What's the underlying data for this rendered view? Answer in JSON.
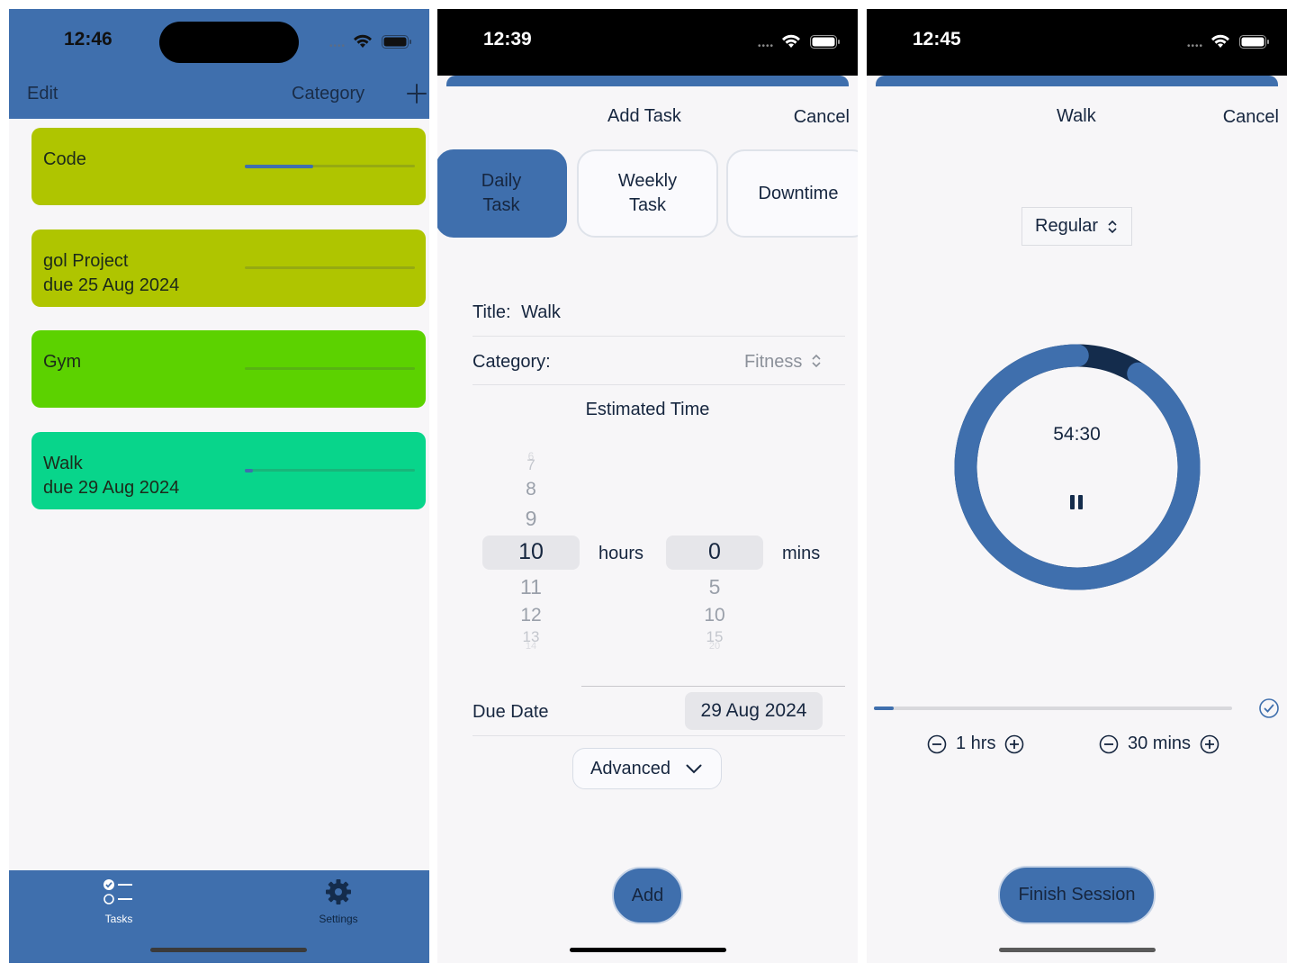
{
  "screen1": {
    "time": "12:46",
    "nav": {
      "edit": "Edit",
      "category": "Category"
    },
    "tasks": [
      {
        "title": "Code",
        "due": "",
        "color": "#afc500",
        "progress": 0.4
      },
      {
        "title": "gol Project",
        "due": "due 25 Aug 2024",
        "color": "#afc500",
        "progress": 0
      },
      {
        "title": "Gym",
        "due": "",
        "color": "#5cd200",
        "progress": 0
      },
      {
        "title": "Walk",
        "due": "due 29 Aug 2024",
        "color": "#08d58b",
        "progress": 0.05
      }
    ],
    "tabs": {
      "tasks": "Tasks",
      "settings": "Settings"
    }
  },
  "screen2": {
    "time": "12:39",
    "title": "Add Task",
    "cancel": "Cancel",
    "segments": {
      "daily": "Daily\nTask",
      "weekly": "Weekly\nTask",
      "downtime": "Downtime"
    },
    "title_label": "Title:",
    "title_value": "Walk",
    "category_label": "Category:",
    "category_value": "Fitness",
    "estimated_time": "Estimated Time",
    "hours_wheel": {
      "above": [
        "6",
        "7",
        "8",
        "9"
      ],
      "selected": "10",
      "below": [
        "11",
        "12",
        "13",
        "14"
      ]
    },
    "mins_wheel": {
      "selected": "0",
      "below": [
        "5",
        "10",
        "15",
        "20"
      ]
    },
    "hours_unit": "hours",
    "mins_unit": "mins",
    "due_label": "Due Date",
    "due_value": "29 Aug 2024",
    "advanced": "Advanced",
    "add": "Add"
  },
  "screen3": {
    "time": "12:45",
    "title": "Walk",
    "cancel": "Cancel",
    "mode": "Regular",
    "timer": "54:30",
    "ring_progress": 0.908,
    "session_progress": 0.055,
    "hours": "1 hrs",
    "mins": "30 mins",
    "finish": "Finish Session"
  },
  "colors": {
    "accent": "#3f6fad",
    "text": "#16263f",
    "background": "#f7f6f8",
    "ring_dark": "#142c4c"
  }
}
